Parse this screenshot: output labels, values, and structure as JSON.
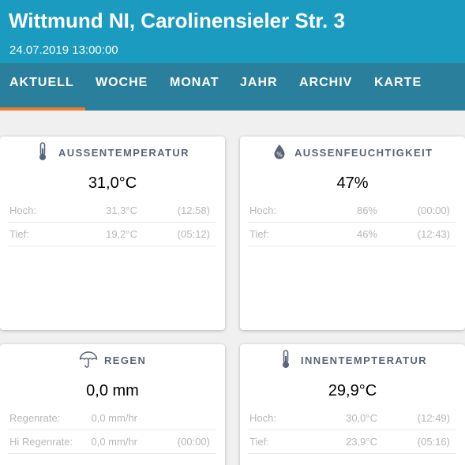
{
  "header": {
    "title": "Wittmund NI, Carolinensieler Str. 3",
    "datetime": "24.07.2019 13:00:00"
  },
  "tabs": [
    {
      "label": "AKTUELL",
      "active": true
    },
    {
      "label": "WOCHE"
    },
    {
      "label": "MONAT"
    },
    {
      "label": "JAHR"
    },
    {
      "label": "ARCHIV"
    },
    {
      "label": "KARTE"
    }
  ],
  "colors": {
    "header": "#1a9bbf",
    "tabbar": "#2a7f9c",
    "active_tab_indicator": "#f07a2a"
  },
  "cards": {
    "outside_temp": {
      "icon": "thermometer-icon",
      "title": "AUSSENTEMPERATUR",
      "value": "31,0°C",
      "rows": [
        {
          "label": "Hoch:",
          "value": "31,3°C",
          "time": "(12:58)"
        },
        {
          "label": "Tief:",
          "value": "19,2°C",
          "time": "(05:12)"
        }
      ]
    },
    "outside_humidity": {
      "icon": "humidity-drop-icon",
      "title": "AUSSENFEUCHTIGKEIT",
      "value": "47%",
      "rows": [
        {
          "label": "Hoch:",
          "value": "86%",
          "time": "(00:00)"
        },
        {
          "label": "Tief:",
          "value": "46%",
          "time": "(12:43)"
        }
      ]
    },
    "rain": {
      "icon": "umbrella-icon",
      "title": "REGEN",
      "value": "0,0 mm",
      "rows": [
        {
          "label": "Regenrate:",
          "value": "0,0 mm/hr",
          "time": ""
        },
        {
          "label": "Hi Regenrate:",
          "value": "0,0 mm/hr",
          "time": "(00:00)"
        }
      ]
    },
    "inside_temp": {
      "icon": "thermometer-icon",
      "title": "INNENTEMPTERATUR",
      "value": "29,9°C",
      "rows": [
        {
          "label": "Hoch:",
          "value": "30,0°C",
          "time": "(12:49)"
        },
        {
          "label": "Tief:",
          "value": "23,9°C",
          "time": "(05:16)"
        }
      ]
    }
  }
}
